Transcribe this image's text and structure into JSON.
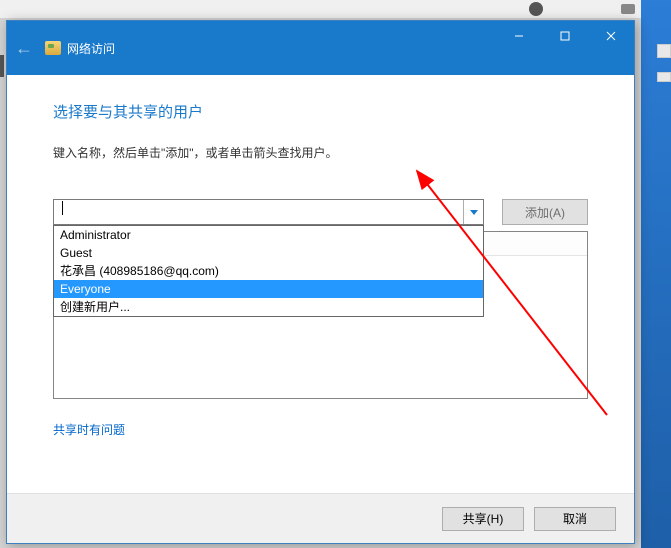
{
  "titlebar": {
    "title": "网络访问"
  },
  "page": {
    "heading": "选择要与其共享的用户",
    "subtext": "键入名称，然后单击\"添加\"，或者单击箭头查找用户。"
  },
  "combo": {
    "input_value": "",
    "add_button": "添加(A)"
  },
  "dropdown": {
    "items": [
      {
        "label": "Administrator",
        "selected": false
      },
      {
        "label": "Guest",
        "selected": false
      },
      {
        "label": "花承昌 (408985186@qq.com)",
        "selected": false
      },
      {
        "label": "Everyone",
        "selected": true
      },
      {
        "label": "创建新用户...",
        "selected": false
      }
    ]
  },
  "links": {
    "help": "共享时有问题"
  },
  "footer": {
    "share": "共享(H)",
    "cancel": "取消"
  }
}
